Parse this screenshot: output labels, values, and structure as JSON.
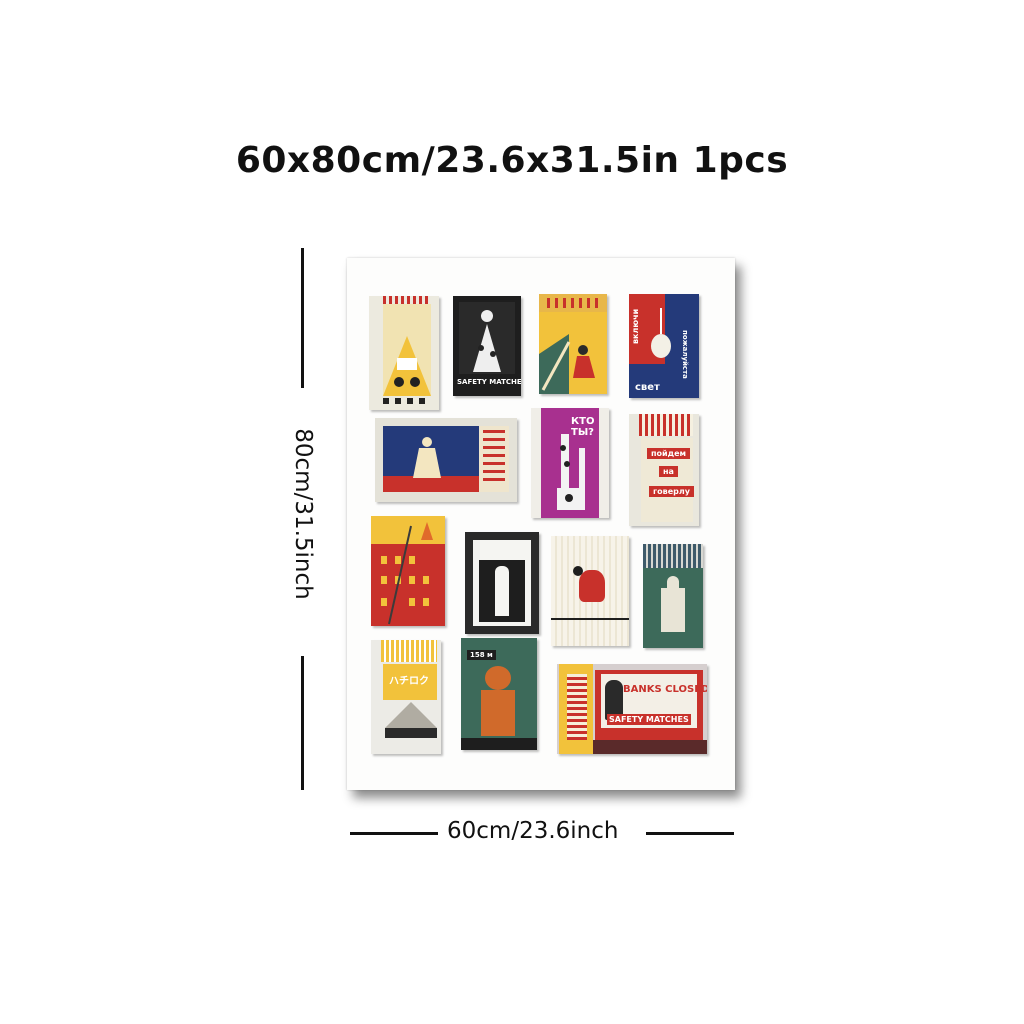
{
  "header": {
    "title": "60x80cm/23.6x31.5in 1pcs"
  },
  "dimensions": {
    "height_label": "80cm/31.5inch",
    "width_label": "60cm/23.6inch"
  },
  "poster": {
    "matchbox_labels": {
      "safety_matches_1": "SAFETY MATCHES",
      "vklyuchi": "включи",
      "svet": "свет",
      "pozhaluysta": "пожалуйста",
      "kto_ty": "КТО ТЫ?",
      "poydem": "пойдем",
      "na": "на",
      "goverlu": "говерлу",
      "hachiroku": "ハチロク",
      "depth": "158 м",
      "banks_closed": "BANKS CLOSED",
      "safety_matches_2": "SAFETY MATCHES"
    }
  },
  "colors": {
    "red": "#c8312b",
    "yellow": "#f2c23b",
    "navy": "#243a7a",
    "green": "#3d6a5a",
    "magenta": "#a8308f"
  }
}
